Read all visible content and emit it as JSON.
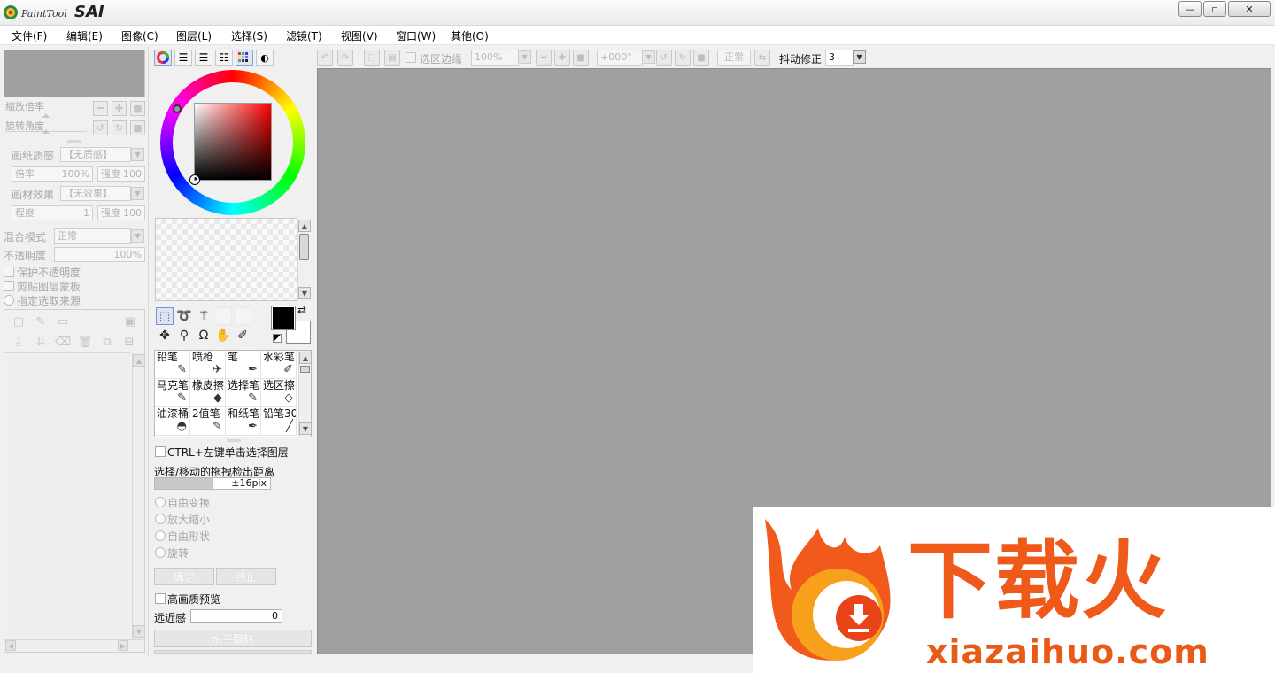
{
  "app": {
    "logo_sub": "PaintTool",
    "logo_main": "SAI",
    "window_controls": {
      "minimize": "—",
      "restore": "▫",
      "close": "✕"
    }
  },
  "menu": [
    "文件(F)",
    "编辑(E)",
    "图像(C)",
    "图层(L)",
    "选择(S)",
    "滤镜(T)",
    "视图(V)",
    "窗口(W)",
    "其他(O)"
  ],
  "toolbar": {
    "selection_edge_label": "选区边缘",
    "zoom_value": "100%",
    "rotate_value": "+000°",
    "blend_value": "正常",
    "stabilizer_label": "抖动修正",
    "stabilizer_value": "3"
  },
  "left_panel": {
    "zoom_label": "缩放倍率",
    "rotate_label": "旋转角度",
    "paper_texture_label": "画纸质感",
    "paper_texture_value": "【无质感】",
    "scale_label": "倍率",
    "scale_value": "100%",
    "strength_label": "强度",
    "strength_value": "100",
    "material_effect_label": "画材效果",
    "material_effect_value": "【无效果】",
    "degree_label": "程度",
    "degree_value": "1",
    "strength2_label": "强度",
    "strength2_value": "100",
    "blend_mode_label": "混合模式",
    "blend_mode_value": "正常",
    "opacity_label": "不透明度",
    "opacity_value": "100%",
    "protect_opacity": "保护不透明度",
    "clipping_group": "剪贴图层蒙板",
    "selection_source": "指定选取来源"
  },
  "tool_options": {
    "ctrl_select": "CTRL+左键单击选择图层",
    "drag_distance_label": "选择/移动的拖拽检出距离",
    "drag_distance_value": "±16pix",
    "free_transform": "自由变换",
    "scale": "放大缩小",
    "free_shape": "自由形状",
    "rotate": "旋转",
    "ok": "确定",
    "cancel": "终止",
    "hq_preview": "高画质预览",
    "perspective_label": "远近感",
    "perspective_value": "0",
    "flip_horizontal": "水平翻转"
  },
  "brushes": [
    {
      "name": "铅笔",
      "icon": "pencil-icon",
      "glyph": "✎"
    },
    {
      "name": "喷枪",
      "icon": "airbrush-icon",
      "glyph": "✈"
    },
    {
      "name": "笔",
      "icon": "pen-icon",
      "glyph": "✒"
    },
    {
      "name": "水彩笔",
      "icon": "watercolor-icon",
      "glyph": "✐"
    },
    {
      "name": "马克笔",
      "icon": "marker-icon",
      "glyph": "✎"
    },
    {
      "name": "橡皮擦",
      "icon": "eraser-icon",
      "glyph": "◆"
    },
    {
      "name": "选择笔",
      "icon": "select-pen-icon",
      "glyph": "✎"
    },
    {
      "name": "选区擦",
      "icon": "select-eraser-icon",
      "glyph": "◇"
    },
    {
      "name": "油漆桶",
      "icon": "bucket-icon",
      "glyph": "◓"
    },
    {
      "name": "2值笔",
      "icon": "binary-pen-icon",
      "glyph": "✎"
    },
    {
      "name": "和纸笔",
      "icon": "washi-pen-icon",
      "glyph": "✒"
    },
    {
      "name": "铅笔30",
      "icon": "pencil30-icon",
      "glyph": "╱"
    }
  ],
  "colors": {
    "foreground": "#000000",
    "background": "#ffffff",
    "canvas": "#a0a0a0",
    "accent": "#ef5a1a"
  },
  "watermark": {
    "title": "下载火",
    "url": "xiazaihuo.com"
  }
}
